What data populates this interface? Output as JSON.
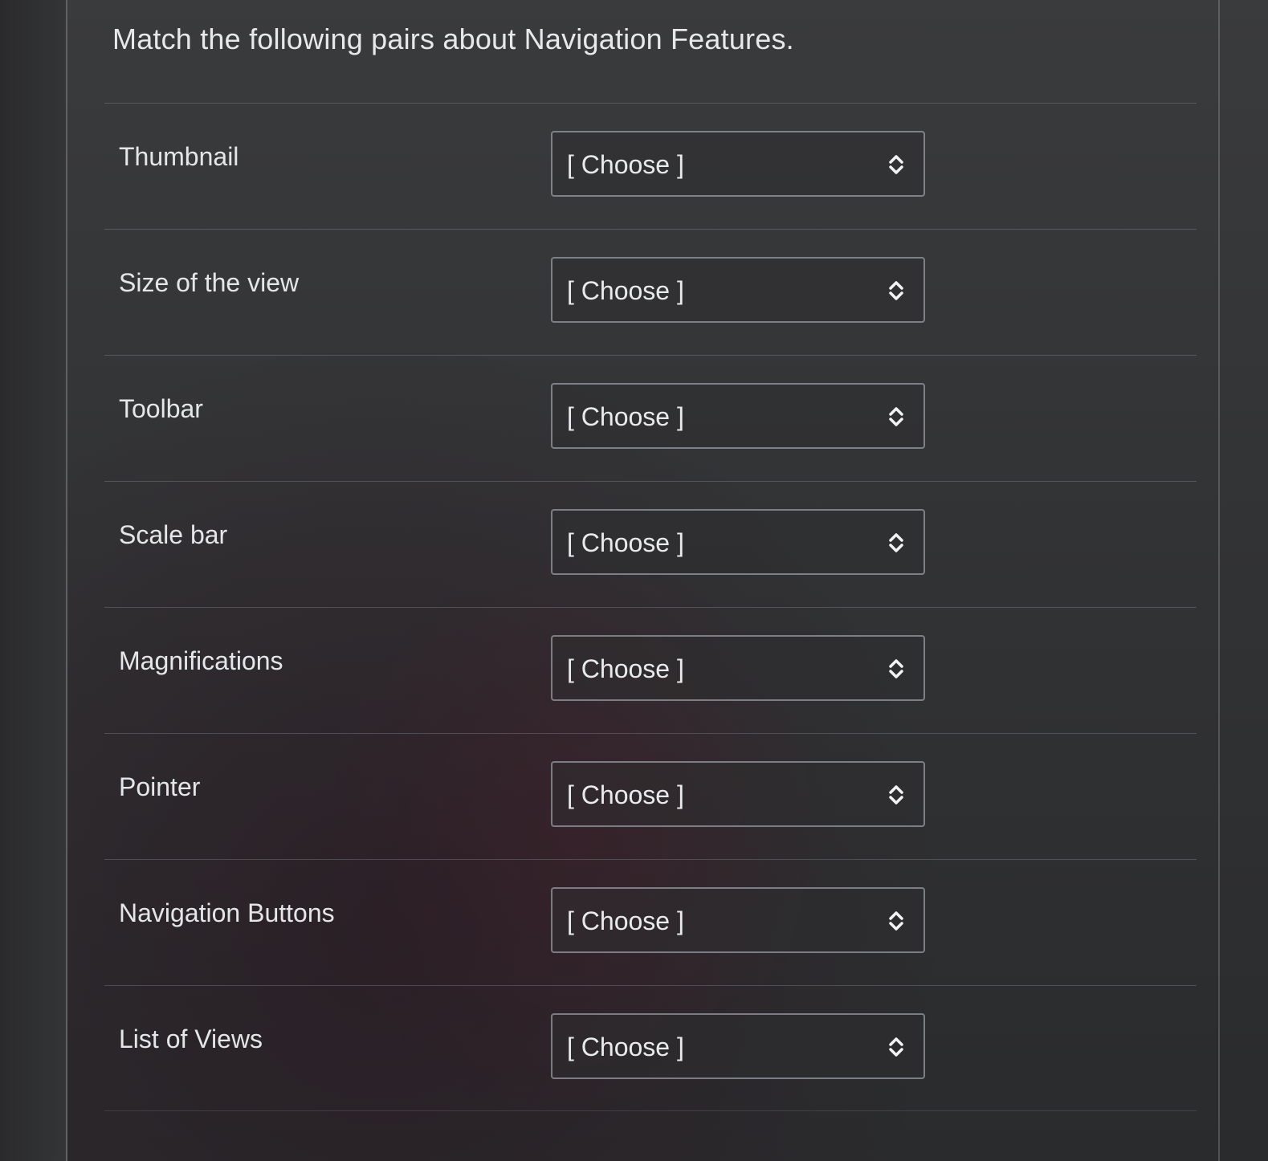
{
  "question": {
    "title": "Match the following pairs about Navigation Features."
  },
  "pairs": [
    {
      "label": "Thumbnail",
      "selected": "[ Choose ]"
    },
    {
      "label": "Size of the view",
      "selected": "[ Choose ]"
    },
    {
      "label": "Toolbar",
      "selected": "[ Choose ]"
    },
    {
      "label": "Scale bar",
      "selected": "[ Choose ]"
    },
    {
      "label": "Magnifications",
      "selected": "[ Choose ]"
    },
    {
      "label": "Pointer",
      "selected": "[ Choose ]"
    },
    {
      "label": "Navigation Buttons",
      "selected": "[ Choose ]"
    },
    {
      "label": "List of Views",
      "selected": "[ Choose ]"
    }
  ],
  "icons": {
    "select_arrow": "up-down-chevron-icon"
  },
  "colors": {
    "background": "#2e2f31",
    "text": "#e4e6e8",
    "border": "#bec3c8"
  }
}
